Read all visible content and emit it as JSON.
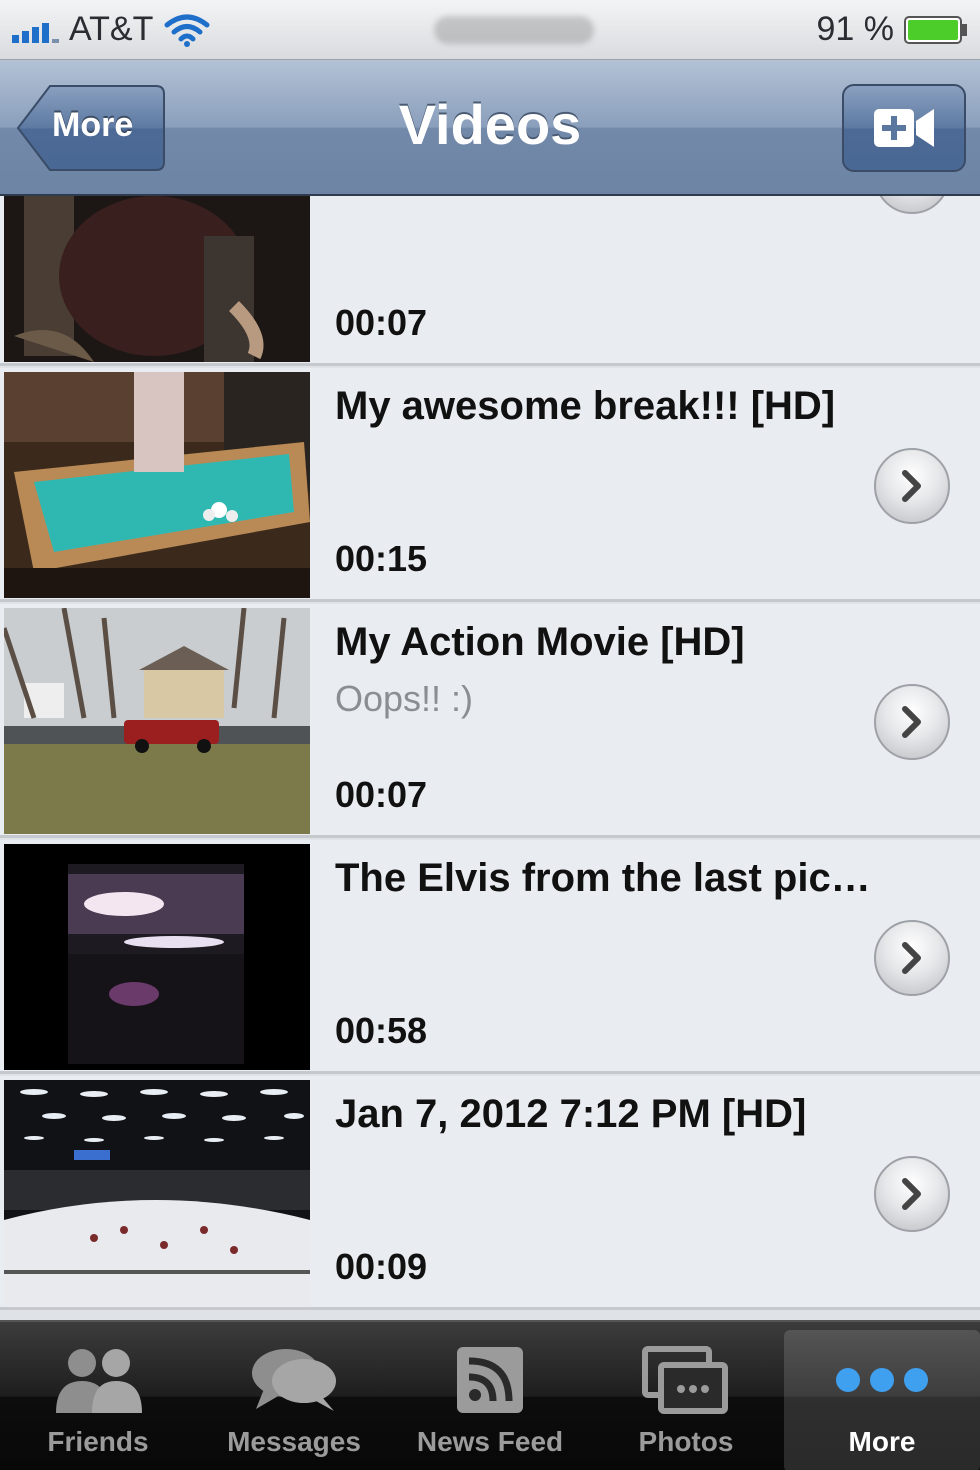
{
  "status_bar": {
    "carrier": "AT&T",
    "battery": "91 %",
    "signal_icon": "cellular-signal-icon",
    "wifi_icon": "wifi-icon",
    "battery_icon": "battery-icon",
    "battery_color": "#4ccd2a"
  },
  "nav": {
    "title": "Videos",
    "back_label": "More",
    "right_icon": "video-camera-add-icon",
    "bar_color": "#7289aa"
  },
  "videos": [
    {
      "title": "",
      "subtitle": "",
      "duration": "00:07"
    },
    {
      "title": "My awesome break!!! [HD]",
      "subtitle": "",
      "duration": "00:15"
    },
    {
      "title": "My Action Movie [HD]",
      "subtitle": "Oops!! :)",
      "duration": "00:07"
    },
    {
      "title": "The Elvis from the last pic…",
      "subtitle": "",
      "duration": "00:58"
    },
    {
      "title": "Jan 7, 2012 7:12 PM [HD]",
      "subtitle": "",
      "duration": "00:09"
    }
  ],
  "tabs": [
    {
      "label": "Friends",
      "icon": "friends-icon",
      "active": false
    },
    {
      "label": "Messages",
      "icon": "messages-icon",
      "active": false
    },
    {
      "label": "News Feed",
      "icon": "rss-feed-icon",
      "active": false
    },
    {
      "label": "Photos",
      "icon": "photos-icon",
      "active": false
    },
    {
      "label": "More",
      "icon": "more-dots-icon",
      "active": true
    }
  ]
}
